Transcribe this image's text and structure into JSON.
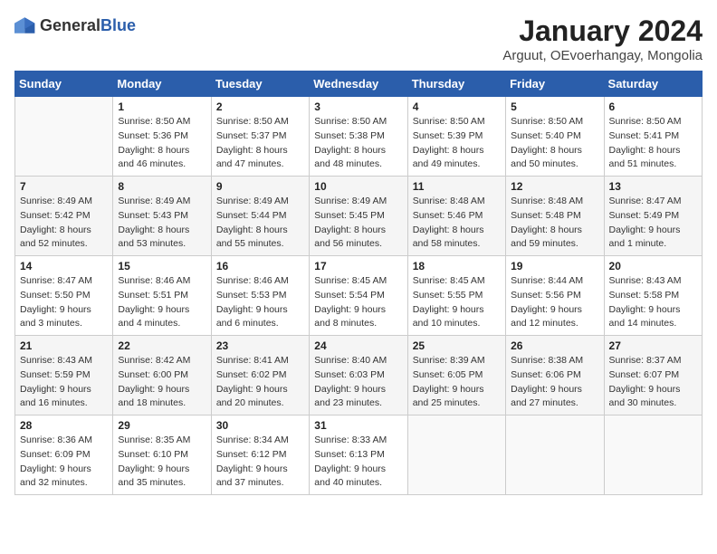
{
  "logo": {
    "general": "General",
    "blue": "Blue"
  },
  "title": "January 2024",
  "subtitle": "Arguut, OEvoerhangay, Mongolia",
  "days_of_week": [
    "Sunday",
    "Monday",
    "Tuesday",
    "Wednesday",
    "Thursday",
    "Friday",
    "Saturday"
  ],
  "weeks": [
    [
      {
        "day": "",
        "info": ""
      },
      {
        "day": "1",
        "info": "Sunrise: 8:50 AM\nSunset: 5:36 PM\nDaylight: 8 hours\nand 46 minutes."
      },
      {
        "day": "2",
        "info": "Sunrise: 8:50 AM\nSunset: 5:37 PM\nDaylight: 8 hours\nand 47 minutes."
      },
      {
        "day": "3",
        "info": "Sunrise: 8:50 AM\nSunset: 5:38 PM\nDaylight: 8 hours\nand 48 minutes."
      },
      {
        "day": "4",
        "info": "Sunrise: 8:50 AM\nSunset: 5:39 PM\nDaylight: 8 hours\nand 49 minutes."
      },
      {
        "day": "5",
        "info": "Sunrise: 8:50 AM\nSunset: 5:40 PM\nDaylight: 8 hours\nand 50 minutes."
      },
      {
        "day": "6",
        "info": "Sunrise: 8:50 AM\nSunset: 5:41 PM\nDaylight: 8 hours\nand 51 minutes."
      }
    ],
    [
      {
        "day": "7",
        "info": "Sunrise: 8:49 AM\nSunset: 5:42 PM\nDaylight: 8 hours\nand 52 minutes."
      },
      {
        "day": "8",
        "info": "Sunrise: 8:49 AM\nSunset: 5:43 PM\nDaylight: 8 hours\nand 53 minutes."
      },
      {
        "day": "9",
        "info": "Sunrise: 8:49 AM\nSunset: 5:44 PM\nDaylight: 8 hours\nand 55 minutes."
      },
      {
        "day": "10",
        "info": "Sunrise: 8:49 AM\nSunset: 5:45 PM\nDaylight: 8 hours\nand 56 minutes."
      },
      {
        "day": "11",
        "info": "Sunrise: 8:48 AM\nSunset: 5:46 PM\nDaylight: 8 hours\nand 58 minutes."
      },
      {
        "day": "12",
        "info": "Sunrise: 8:48 AM\nSunset: 5:48 PM\nDaylight: 8 hours\nand 59 minutes."
      },
      {
        "day": "13",
        "info": "Sunrise: 8:47 AM\nSunset: 5:49 PM\nDaylight: 9 hours\nand 1 minute."
      }
    ],
    [
      {
        "day": "14",
        "info": "Sunrise: 8:47 AM\nSunset: 5:50 PM\nDaylight: 9 hours\nand 3 minutes."
      },
      {
        "day": "15",
        "info": "Sunrise: 8:46 AM\nSunset: 5:51 PM\nDaylight: 9 hours\nand 4 minutes."
      },
      {
        "day": "16",
        "info": "Sunrise: 8:46 AM\nSunset: 5:53 PM\nDaylight: 9 hours\nand 6 minutes."
      },
      {
        "day": "17",
        "info": "Sunrise: 8:45 AM\nSunset: 5:54 PM\nDaylight: 9 hours\nand 8 minutes."
      },
      {
        "day": "18",
        "info": "Sunrise: 8:45 AM\nSunset: 5:55 PM\nDaylight: 9 hours\nand 10 minutes."
      },
      {
        "day": "19",
        "info": "Sunrise: 8:44 AM\nSunset: 5:56 PM\nDaylight: 9 hours\nand 12 minutes."
      },
      {
        "day": "20",
        "info": "Sunrise: 8:43 AM\nSunset: 5:58 PM\nDaylight: 9 hours\nand 14 minutes."
      }
    ],
    [
      {
        "day": "21",
        "info": "Sunrise: 8:43 AM\nSunset: 5:59 PM\nDaylight: 9 hours\nand 16 minutes."
      },
      {
        "day": "22",
        "info": "Sunrise: 8:42 AM\nSunset: 6:00 PM\nDaylight: 9 hours\nand 18 minutes."
      },
      {
        "day": "23",
        "info": "Sunrise: 8:41 AM\nSunset: 6:02 PM\nDaylight: 9 hours\nand 20 minutes."
      },
      {
        "day": "24",
        "info": "Sunrise: 8:40 AM\nSunset: 6:03 PM\nDaylight: 9 hours\nand 23 minutes."
      },
      {
        "day": "25",
        "info": "Sunrise: 8:39 AM\nSunset: 6:05 PM\nDaylight: 9 hours\nand 25 minutes."
      },
      {
        "day": "26",
        "info": "Sunrise: 8:38 AM\nSunset: 6:06 PM\nDaylight: 9 hours\nand 27 minutes."
      },
      {
        "day": "27",
        "info": "Sunrise: 8:37 AM\nSunset: 6:07 PM\nDaylight: 9 hours\nand 30 minutes."
      }
    ],
    [
      {
        "day": "28",
        "info": "Sunrise: 8:36 AM\nSunset: 6:09 PM\nDaylight: 9 hours\nand 32 minutes."
      },
      {
        "day": "29",
        "info": "Sunrise: 8:35 AM\nSunset: 6:10 PM\nDaylight: 9 hours\nand 35 minutes."
      },
      {
        "day": "30",
        "info": "Sunrise: 8:34 AM\nSunset: 6:12 PM\nDaylight: 9 hours\nand 37 minutes."
      },
      {
        "day": "31",
        "info": "Sunrise: 8:33 AM\nSunset: 6:13 PM\nDaylight: 9 hours\nand 40 minutes."
      },
      {
        "day": "",
        "info": ""
      },
      {
        "day": "",
        "info": ""
      },
      {
        "day": "",
        "info": ""
      }
    ]
  ]
}
